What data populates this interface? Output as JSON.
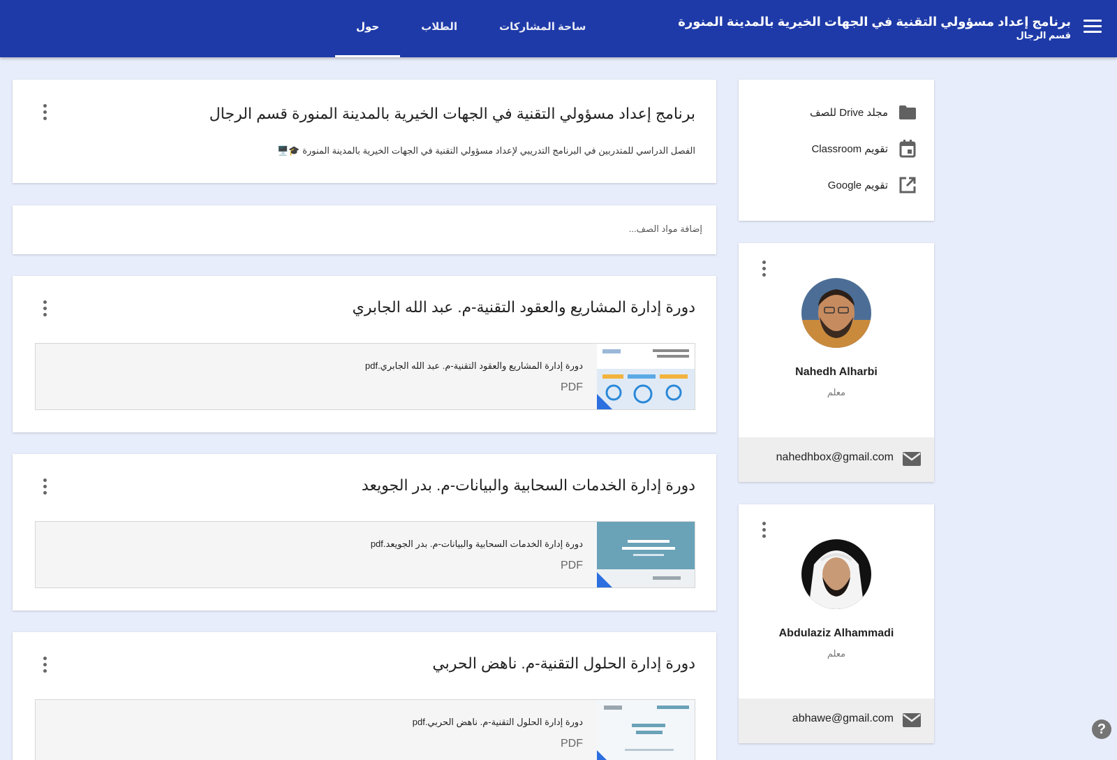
{
  "header": {
    "title": "برنامج إعداد مسؤولي التقنية في الجهات الخيرية بالمدينة المنورة",
    "subtitle": "قسم الرجال",
    "tabs": [
      {
        "label": "حول",
        "active": true
      },
      {
        "label": "الطلاب",
        "active": false
      },
      {
        "label": "ساحة المشاركات",
        "active": false
      }
    ],
    "menu_icon": "hamburger-icon",
    "bar_color": "#1e3aa8"
  },
  "class_header": {
    "title": "برنامج إعداد مسؤولي التقنية في الجهات الخيرية بالمدينة المنورة قسم الرجال",
    "description": "الفصل الدراسي للمتدربين في البرنامج التدريبي لإعداد مسؤولي التقنية في الجهات الخيرية بالمدينة المنورة 🎓🖥️"
  },
  "add_materials": {
    "placeholder": "إضافة مواد الصف..."
  },
  "posts": [
    {
      "title": "دورة إدارة المشاريع والعقود التقنية-م. عبد الله الجابري",
      "file_name": "دورة إدارة المشاريع والعقود التقنية-م. عبد الله الجابري.pdf",
      "file_type": "PDF"
    },
    {
      "title": "دورة إدارة الخدمات السحابية والبيانات-م. بدر الجويعد",
      "file_name": "دورة إدارة الخدمات السحابية والبيانات-م. بدر الجويعد.pdf",
      "file_type": "PDF"
    },
    {
      "title": "دورة إدارة الحلول التقنية-م. ناهض الحربي",
      "file_name": "دورة إدارة الحلول التقنية-م. ناهض الحربي.pdf",
      "file_type": "PDF"
    }
  ],
  "links": [
    {
      "label": "مجلد Drive للصف",
      "icon": "folder-icon"
    },
    {
      "label": "تقويم Classroom",
      "icon": "calendar-icon"
    },
    {
      "label": "تقويم Google",
      "icon": "open-in-new-icon"
    }
  ],
  "teachers": [
    {
      "name": "Nahedh Alharbi",
      "role": "معلم",
      "email": "nahedhbox@gmail.com"
    },
    {
      "name": "Abdulaziz Alhammadi",
      "role": "معلم",
      "email": "abhawe@gmail.com"
    }
  ],
  "help": {
    "label": "?"
  }
}
